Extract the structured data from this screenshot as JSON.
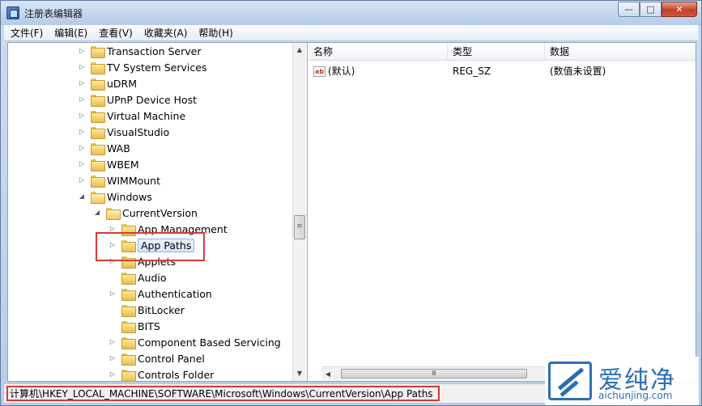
{
  "window": {
    "title": "注册表编辑器"
  },
  "window_buttons": {
    "minimize": "—",
    "maximize": "□",
    "close": "✕"
  },
  "menu": [
    "文件(F)",
    "编辑(E)",
    "查看(V)",
    "收藏夹(A)",
    "帮助(H)"
  ],
  "tree": {
    "items": [
      {
        "label": "Transaction Server",
        "expander": "▷"
      },
      {
        "label": "TV System Services",
        "expander": "▷"
      },
      {
        "label": "uDRM",
        "expander": "▷"
      },
      {
        "label": "UPnP Device Host",
        "expander": "▷"
      },
      {
        "label": "Virtual Machine",
        "expander": "▷"
      },
      {
        "label": "VisualStudio",
        "expander": "▷"
      },
      {
        "label": "WAB",
        "expander": "▷"
      },
      {
        "label": "WBEM",
        "expander": "▷"
      },
      {
        "label": "WIMMount",
        "expander": "▷"
      },
      {
        "label": "Windows",
        "expander": "◢"
      },
      {
        "label": "CurrentVersion",
        "expander": "◢"
      },
      {
        "label": "App Management",
        "expander": "▷"
      },
      {
        "label": "App Paths",
        "expander": "▷"
      },
      {
        "label": "Applets",
        "expander": "▷"
      },
      {
        "label": "Audio",
        "expander": ""
      },
      {
        "label": "Authentication",
        "expander": "▷"
      },
      {
        "label": "BitLocker",
        "expander": ""
      },
      {
        "label": "BITS",
        "expander": ""
      },
      {
        "label": "Component Based Servicing",
        "expander": "▷"
      },
      {
        "label": "Control Panel",
        "expander": "▷"
      },
      {
        "label": "Controls Folder",
        "expander": "▷"
      }
    ]
  },
  "values": {
    "columns": [
      "名称",
      "类型",
      "数据"
    ],
    "rows": [
      {
        "name": "(默认)",
        "type": "REG_SZ",
        "data": "(数值未设置)",
        "icon": "ab"
      }
    ]
  },
  "scroll": {
    "up": "▲",
    "down": "▼",
    "left": "◀",
    "grip": "≡",
    "hgrip": "Ⅲ"
  },
  "statusbar": {
    "path": "计算机\\HKEY_LOCAL_MACHINE\\SOFTWARE\\Microsoft\\Windows\\CurrentVersion\\App Paths"
  },
  "watermark": {
    "title": "爱纯净",
    "domain": "aichunjing.com"
  },
  "colors": {
    "highlight": "#d33b3b",
    "watermark": "#2a6fb5",
    "selection": "#d3e5fa"
  }
}
